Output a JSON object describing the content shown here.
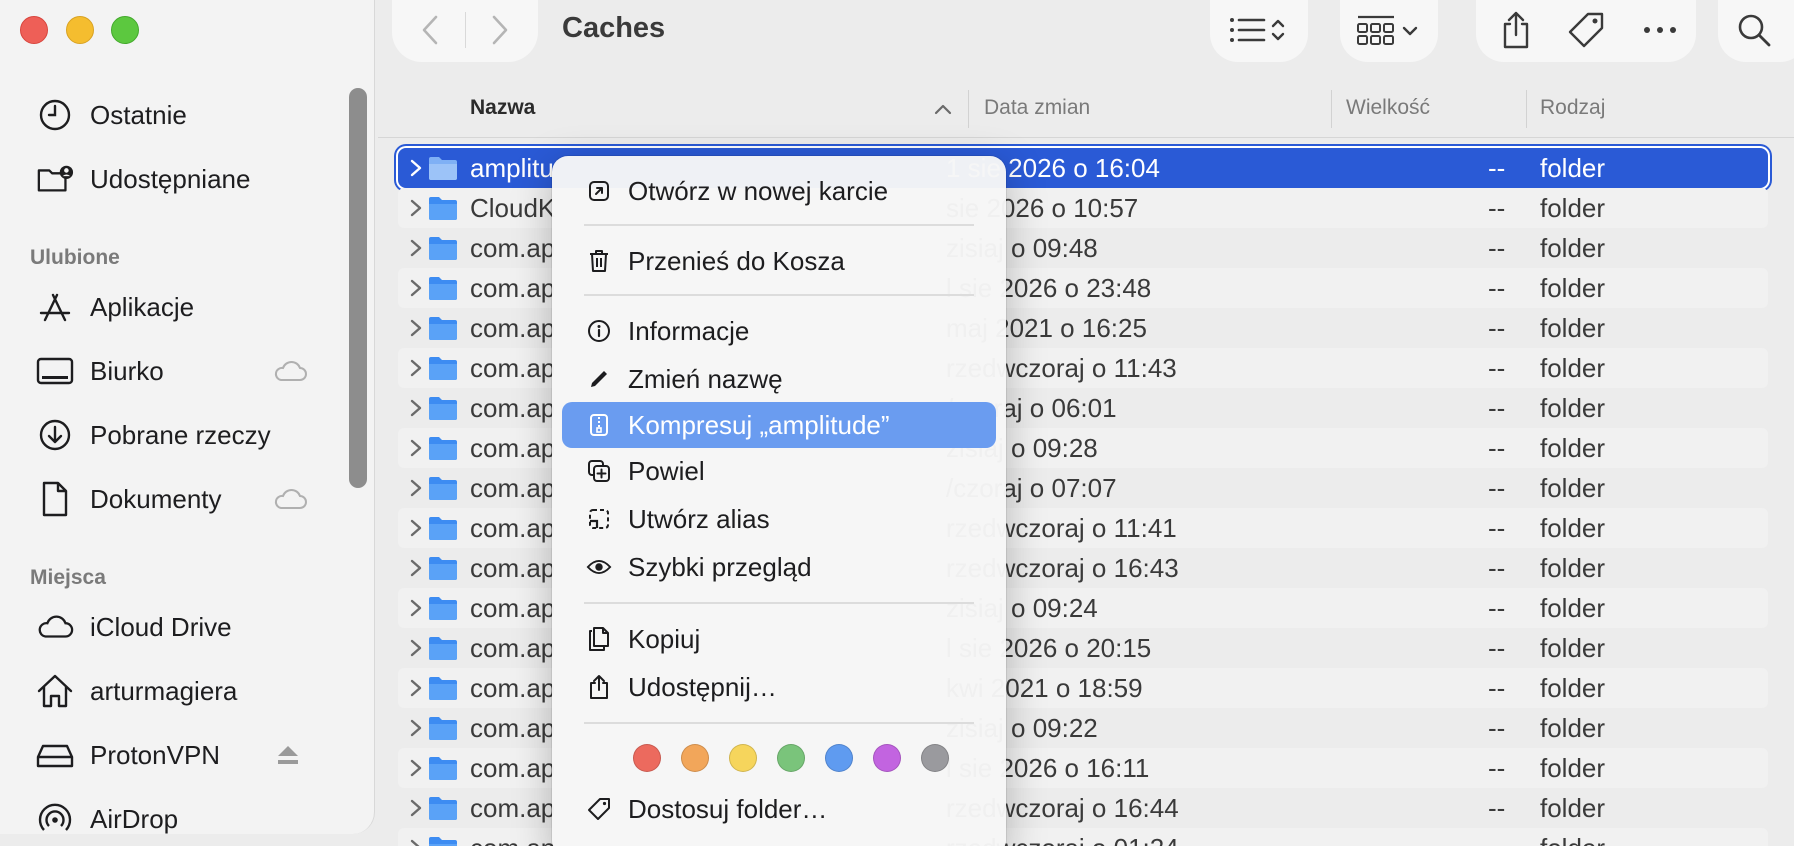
{
  "window": {
    "title": "Caches"
  },
  "sidebar": {
    "items": [
      {
        "label": "Ostatnie",
        "icon": "clock-icon"
      },
      {
        "label": "Udostępniane",
        "icon": "shared-folder-icon"
      }
    ],
    "sections": [
      {
        "title": "Ulubione",
        "items": [
          {
            "label": "Aplikacje",
            "icon": "applications-icon"
          },
          {
            "label": "Biurko",
            "icon": "desktop-icon",
            "cloud": true
          },
          {
            "label": "Pobrane rzeczy",
            "icon": "download-icon"
          },
          {
            "label": "Dokumenty",
            "icon": "document-icon",
            "cloud": true
          }
        ]
      },
      {
        "title": "Miejsca",
        "items": [
          {
            "label": "iCloud Drive",
            "icon": "cloud-icon"
          },
          {
            "label": "arturmagiera",
            "icon": "home-icon"
          },
          {
            "label": "ProtonVPN",
            "icon": "drive-icon",
            "eject": true
          },
          {
            "label": "AirDrop",
            "icon": "airdrop-icon"
          }
        ]
      }
    ]
  },
  "columns": {
    "name": "Nazwa",
    "date": "Data zmian",
    "size": "Wielkość",
    "kind": "Rodzaj"
  },
  "files": [
    {
      "name": "amplitu",
      "date": "1 sie 2026 o 16:04",
      "size": "--",
      "kind": "folder",
      "selected": true
    },
    {
      "name": "CloudK",
      "date": "sie 2026 o 10:57",
      "size": "--",
      "kind": "folder"
    },
    {
      "name": "com.ap",
      "date": "zisiaj o 09:48",
      "size": "--",
      "kind": "folder"
    },
    {
      "name": "com.ap",
      "date": "l sie 2026 o 23:48",
      "size": "--",
      "kind": "folder"
    },
    {
      "name": "com.ap",
      "date": "maj 2021 o 16:25",
      "size": "--",
      "kind": "folder"
    },
    {
      "name": "com.ap",
      "date": "rzedwczoraj o 11:43",
      "size": "--",
      "kind": "folder"
    },
    {
      "name": "com.ap",
      "date": "/czoraj o 06:01",
      "size": "--",
      "kind": "folder"
    },
    {
      "name": "com.ap",
      "date": "zisiaj o 09:28",
      "size": "--",
      "kind": "folder"
    },
    {
      "name": "com.ap",
      "date": "/czoraj o 07:07",
      "size": "--",
      "kind": "folder"
    },
    {
      "name": "com.ap",
      "date": "rzedwczoraj o 11:41",
      "size": "--",
      "kind": "folder"
    },
    {
      "name": "com.ap",
      "date": "rzedwczoraj o 16:43",
      "size": "--",
      "kind": "folder"
    },
    {
      "name": "com.ap",
      "date": "zisiaj o 09:24",
      "size": "--",
      "kind": "folder"
    },
    {
      "name": "com.ap",
      "date": "l sie 2026 o 20:15",
      "size": "--",
      "kind": "folder"
    },
    {
      "name": "com.ap",
      "date": "kwi 2021 o 18:59",
      "size": "--",
      "kind": "folder"
    },
    {
      "name": "com.ap",
      "date": "zisiaj o 09:22",
      "size": "--",
      "kind": "folder"
    },
    {
      "name": "com.ap",
      "date": "l sie 2026 o 16:11",
      "size": "--",
      "kind": "folder"
    },
    {
      "name": "com.ap",
      "date": "rzedwczoraj o 16:44",
      "size": "--",
      "kind": "folder"
    },
    {
      "name": "com.ap",
      "date": "rzedwczoraj o 01:24",
      "size": "--",
      "kind": "folder"
    }
  ],
  "context_menu": {
    "open_new_tab": "Otwórz w nowej karcie",
    "move_to_trash": "Przenieś do Kosza",
    "get_info": "Informacje",
    "rename": "Zmień nazwę",
    "compress": "Kompresuj „amplitude”",
    "duplicate": "Powiel",
    "make_alias": "Utwórz alias",
    "quick_look": "Szybki przegląd",
    "copy": "Kopiuj",
    "share": "Udostępnij…",
    "tag_colors": [
      "#ec6a5e",
      "#f2a65a",
      "#f6d55c",
      "#7ac47b",
      "#5f9bf0",
      "#c264e0",
      "#9a9a9e"
    ],
    "customize_folder": "Dostosuj folder…"
  }
}
